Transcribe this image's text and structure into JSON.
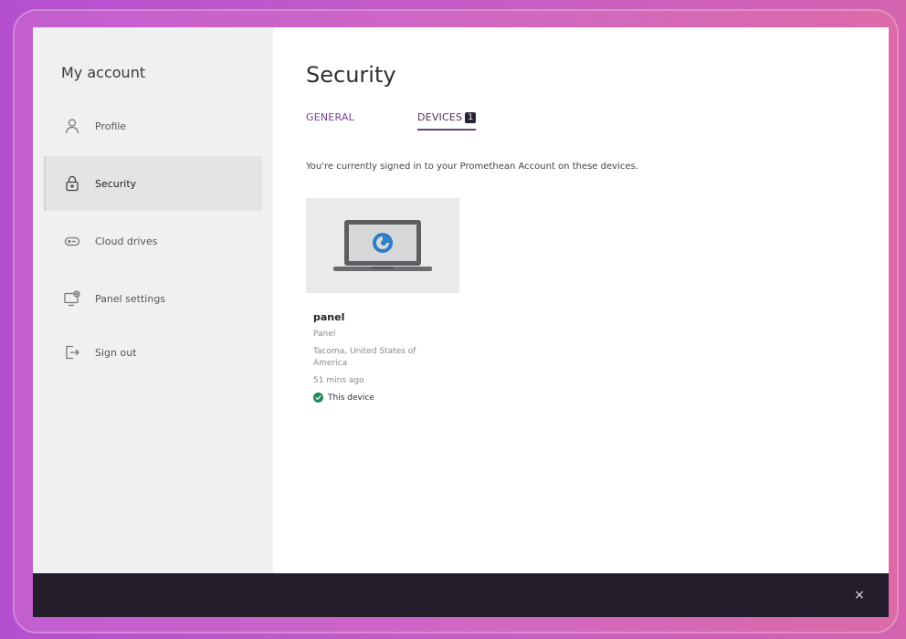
{
  "sidebar": {
    "title": "My account",
    "items": [
      {
        "label": "Profile",
        "icon": "person-icon"
      },
      {
        "label": "Security",
        "icon": "lock-icon",
        "active": true
      },
      {
        "label": "Cloud drives",
        "icon": "cloud-drive-icon"
      },
      {
        "label": "Panel settings",
        "icon": "panel-settings-icon"
      },
      {
        "label": "Sign out",
        "icon": "sign-out-icon"
      }
    ]
  },
  "main": {
    "title": "Security",
    "tabs": [
      {
        "label": "GENERAL"
      },
      {
        "label": "DEVICES",
        "badge": "1",
        "active": true
      }
    ],
    "description": "You're currently signed in to your Promethean Account on these devices.",
    "devices": [
      {
        "name": "panel",
        "type": "Panel",
        "location": "Tacoma, United States of America",
        "last_seen": "51 mins ago",
        "this_device_label": "This device"
      }
    ]
  },
  "footer": {
    "close_symbol": "×"
  },
  "colors": {
    "accent": "#7a3f91",
    "bottom_bar": "#241d2b",
    "sidebar_bg": "#eff1f1",
    "success": "#1f8a5a"
  }
}
